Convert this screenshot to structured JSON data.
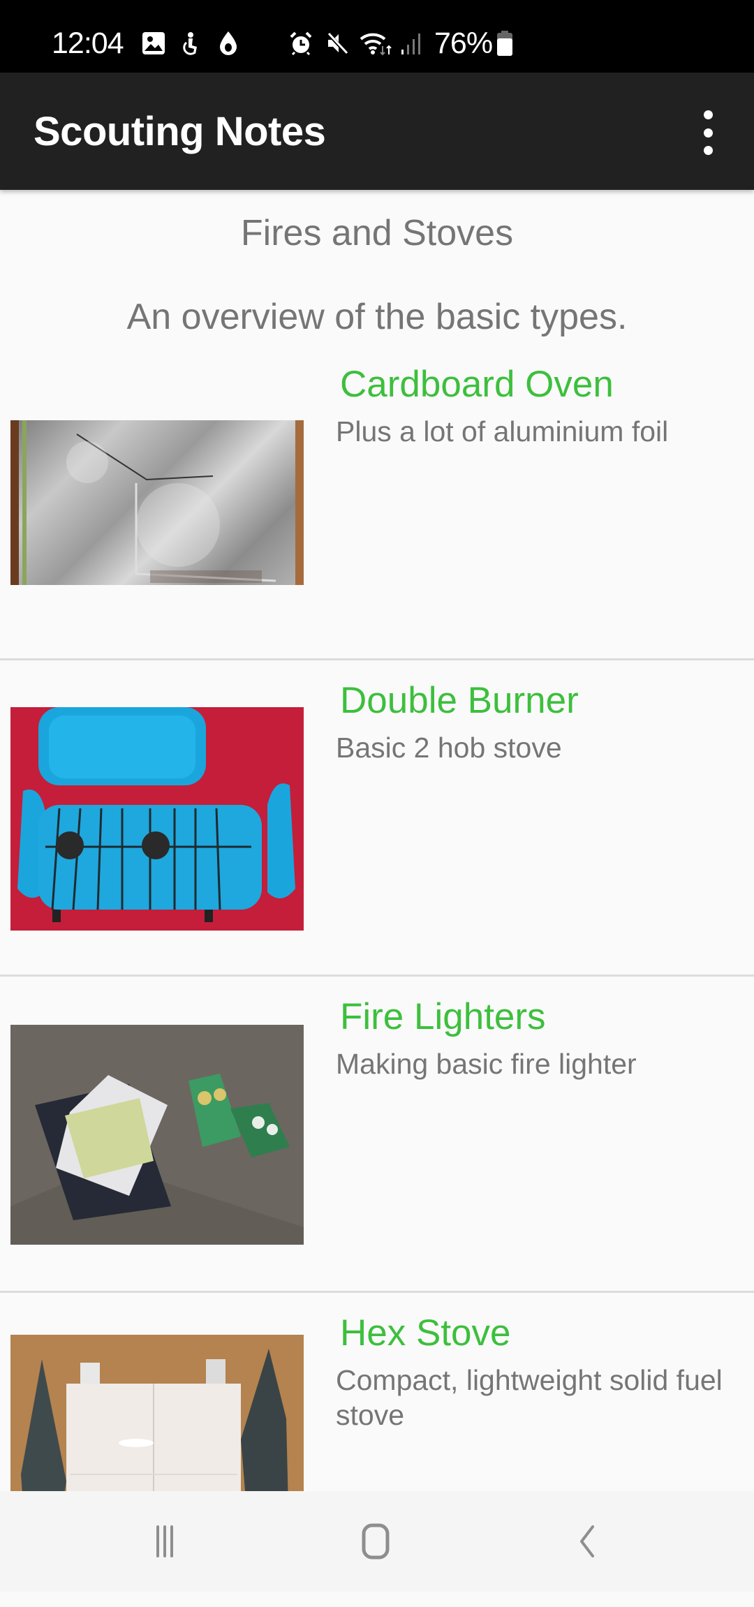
{
  "status_bar": {
    "time": "12:04",
    "battery_percent": "76%",
    "left_icons": [
      "gallery-icon",
      "accessibility-icon",
      "water-drop-icon"
    ],
    "right_icons": [
      "alarm-icon",
      "mute-icon",
      "wifi-icon",
      "signal-icon",
      "battery-icon"
    ]
  },
  "app_bar": {
    "title": "Scouting Notes",
    "menu_icon": "more-vert-icon"
  },
  "page": {
    "title": "Fires and Stoves",
    "subtitle": "An overview of the basic types."
  },
  "items": [
    {
      "title": "Cardboard Oven",
      "description": "Plus a lot of aluminium foil",
      "image": "cardboard-oven-photo"
    },
    {
      "title": "Double Burner",
      "description": "Basic 2 hob stove",
      "image": "double-burner-photo"
    },
    {
      "title": "Fire Lighters",
      "description": "Making basic fire lighter",
      "image": "fire-lighters-photo"
    },
    {
      "title": "Hex Stove",
      "description": "Compact, lightweight solid fuel stove",
      "image": "hex-stove-photo"
    }
  ],
  "colors": {
    "accent": "#3dbf3d",
    "toolbar": "#212121",
    "text_secondary": "#757575",
    "background": "#fafafa"
  },
  "nav_bar": {
    "buttons": [
      "recents-icon",
      "home-icon",
      "back-icon"
    ]
  }
}
